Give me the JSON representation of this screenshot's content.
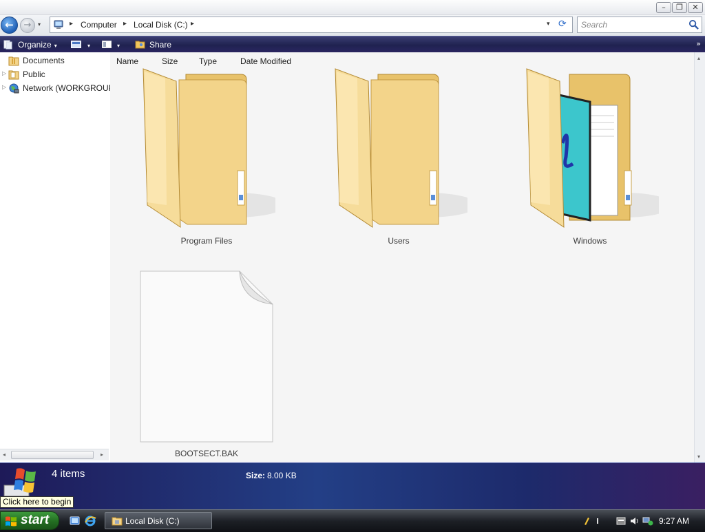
{
  "window": {
    "controls": {
      "minimize": "–",
      "maximize": "❐",
      "close": "✕"
    }
  },
  "nav": {
    "back": "←",
    "forward": "→",
    "dropdown": "▾"
  },
  "address": {
    "separator": "▸",
    "crumbs": [
      "Computer",
      "Local Disk (C:)"
    ],
    "dropdown": "▾",
    "refresh": "⟳"
  },
  "search": {
    "placeholder": "Search"
  },
  "commandbar": {
    "organize": "Organize",
    "share": "Share",
    "arrow": "▾",
    "more": "»"
  },
  "navpane": {
    "expander": "▷",
    "items": [
      {
        "label": "Documents",
        "icon": "documents-folder-icon",
        "expandable": false
      },
      {
        "label": "Public",
        "icon": "folder-icon",
        "expandable": true
      },
      {
        "label": "Network (WORKGROUP",
        "icon": "network-globe-icon",
        "expandable": true
      }
    ],
    "scroll_left": "◂",
    "scroll_right": "▸"
  },
  "columns": [
    "Name",
    "Size",
    "Type",
    "Date Modified"
  ],
  "items": [
    {
      "name": "Program Files",
      "type": "folder"
    },
    {
      "name": "Users",
      "type": "folder"
    },
    {
      "name": "Windows",
      "type": "folder-with-content"
    },
    {
      "name": "BOOTSECT.BAK",
      "type": "file"
    }
  ],
  "scrollbar": {
    "up": "▴",
    "down": "▾"
  },
  "details": {
    "count": "4 items",
    "size_label": "Size:",
    "size_value": "8.00 KB"
  },
  "tooltip": "Click here to begin",
  "taskbar": {
    "start_label": "start",
    "task": "Local Disk (C:)",
    "clock": "9:27 AM"
  },
  "colors": {
    "command_bar": "#1f2250",
    "details_pane": "#233f86",
    "folder": "#f3d48a",
    "start_button": "#2e7f2d"
  }
}
